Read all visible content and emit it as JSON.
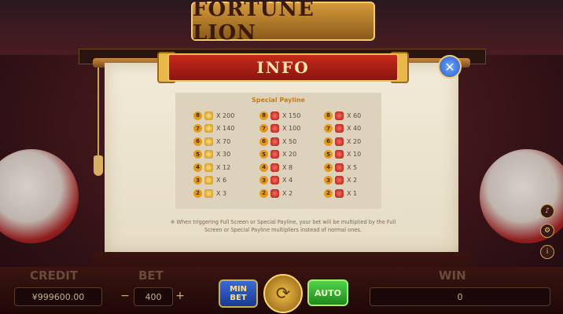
{
  "game": {
    "title": "FORTUNE LION"
  },
  "dialog": {
    "title": "INFO",
    "close_icon": "close-x-icon",
    "table_title": "Special Payline",
    "columns": [
      {
        "symbol": "gold",
        "rows": [
          {
            "count": "8",
            "mult": "X 200"
          },
          {
            "count": "7",
            "mult": "X 140"
          },
          {
            "count": "6",
            "mult": "X 70"
          },
          {
            "count": "5",
            "mult": "X 30"
          },
          {
            "count": "4",
            "mult": "X 12"
          },
          {
            "count": "3",
            "mult": "X 6"
          },
          {
            "count": "2",
            "mult": "X 3"
          }
        ]
      },
      {
        "symbol": "red",
        "rows": [
          {
            "count": "8",
            "mult": "X 150"
          },
          {
            "count": "7",
            "mult": "X 100"
          },
          {
            "count": "6",
            "mult": "X 50"
          },
          {
            "count": "5",
            "mult": "X 20"
          },
          {
            "count": "4",
            "mult": "X 8"
          },
          {
            "count": "3",
            "mult": "X 4"
          },
          {
            "count": "2",
            "mult": "X 2"
          }
        ]
      },
      {
        "symbol": "red",
        "rows": [
          {
            "count": "8",
            "mult": "X 60"
          },
          {
            "count": "7",
            "mult": "X 40"
          },
          {
            "count": "6",
            "mult": "X 20"
          },
          {
            "count": "5",
            "mult": "X 10"
          },
          {
            "count": "4",
            "mult": "X 5"
          },
          {
            "count": "3",
            "mult": "X 2"
          },
          {
            "count": "2",
            "mult": "X 1"
          }
        ]
      }
    ],
    "note": "※ When triggering Full Screen or Special Payline, your bet will be multiplied by the Full Screen or Special Payline multipliers instead of normal ones."
  },
  "bottom_bar": {
    "credit_label": "CREDIT",
    "credit_value": "¥999600.00",
    "bet_label": "BET",
    "bet_value": "400",
    "minus": "−",
    "plus": "+",
    "min_bet_label": "MIN BET",
    "auto_label": "AUTO",
    "win_label": "WIN",
    "win_value": "0"
  }
}
